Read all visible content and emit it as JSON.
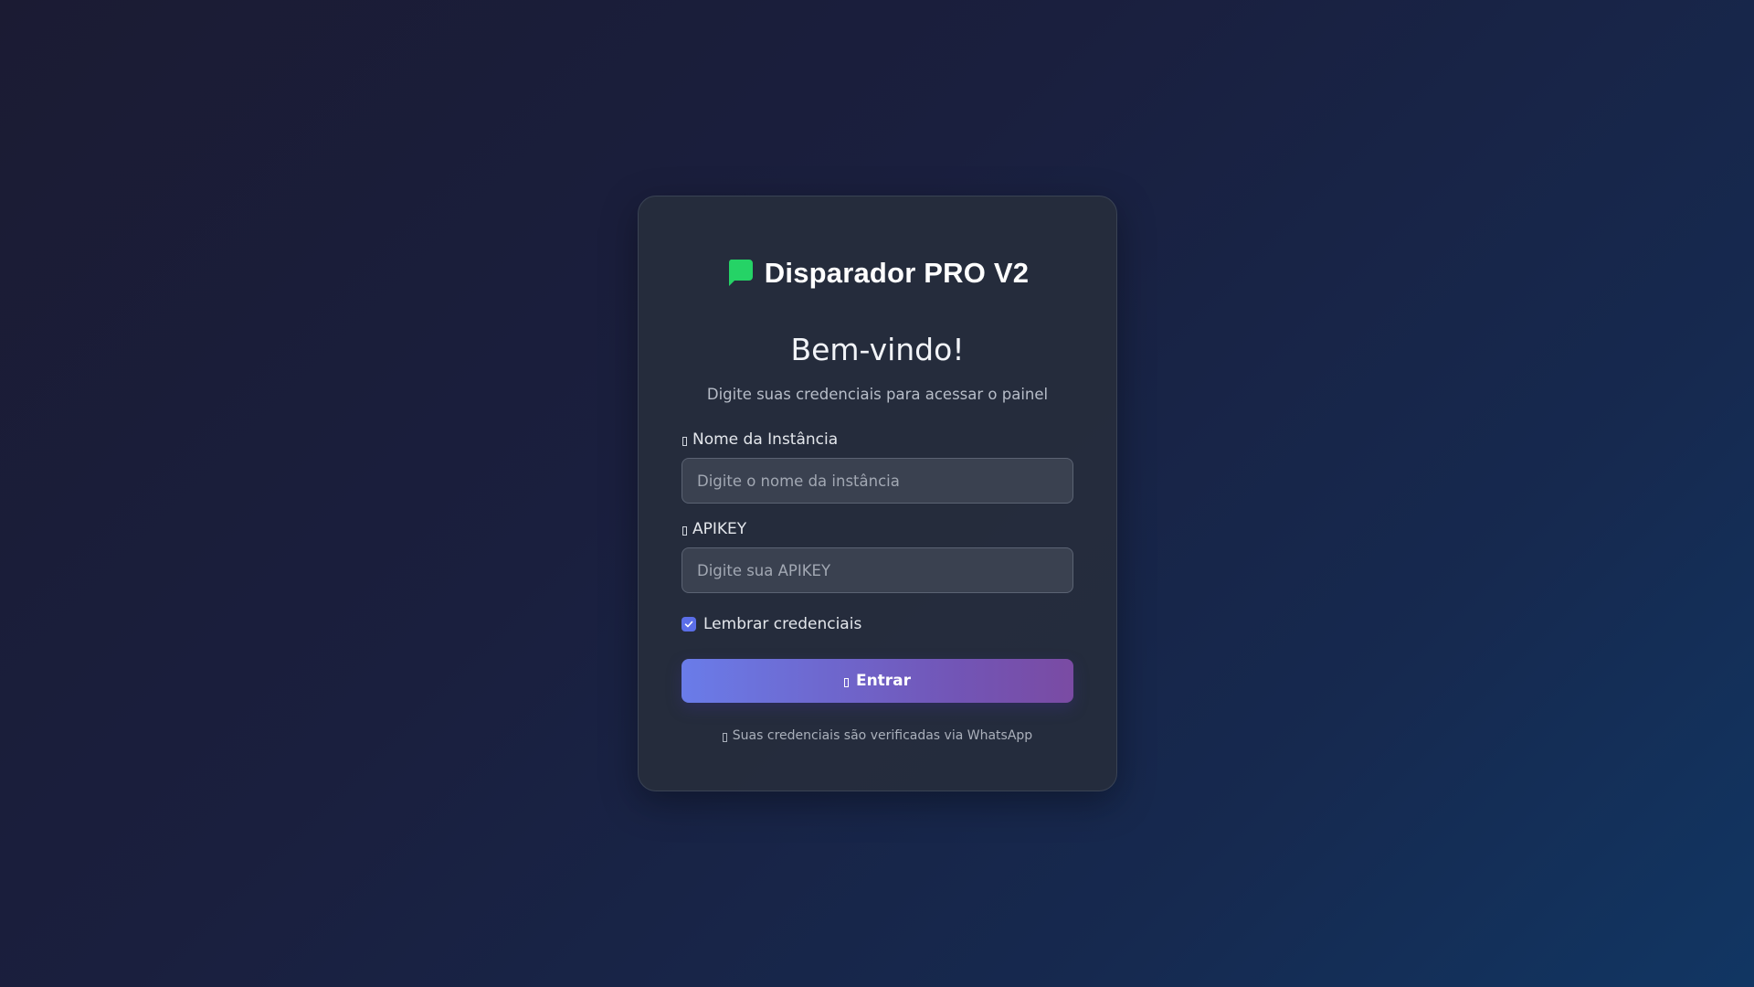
{
  "app": {
    "title": "Disparador PRO V2",
    "accent_color": "#25d366",
    "logo_icon": "chat-bubble-icon"
  },
  "login": {
    "heading": "Bem-vindo!",
    "subtitle": "Digite suas credenciais para acessar o painel",
    "instance_label": "Nome da Instância",
    "instance_value": "",
    "instance_placeholder": "Digite o nome da instância",
    "apikey_label": "APIKEY",
    "apikey_value": "",
    "apikey_placeholder": "Digite sua APIKEY",
    "remember_label": "Lembrar credenciais",
    "remember_checked": true,
    "submit_label": "Entrar",
    "footnote": "Suas credenciais são verificadas via WhatsApp",
    "button_gradient": [
      "#6a7ce9",
      "#7a4ba3"
    ]
  }
}
